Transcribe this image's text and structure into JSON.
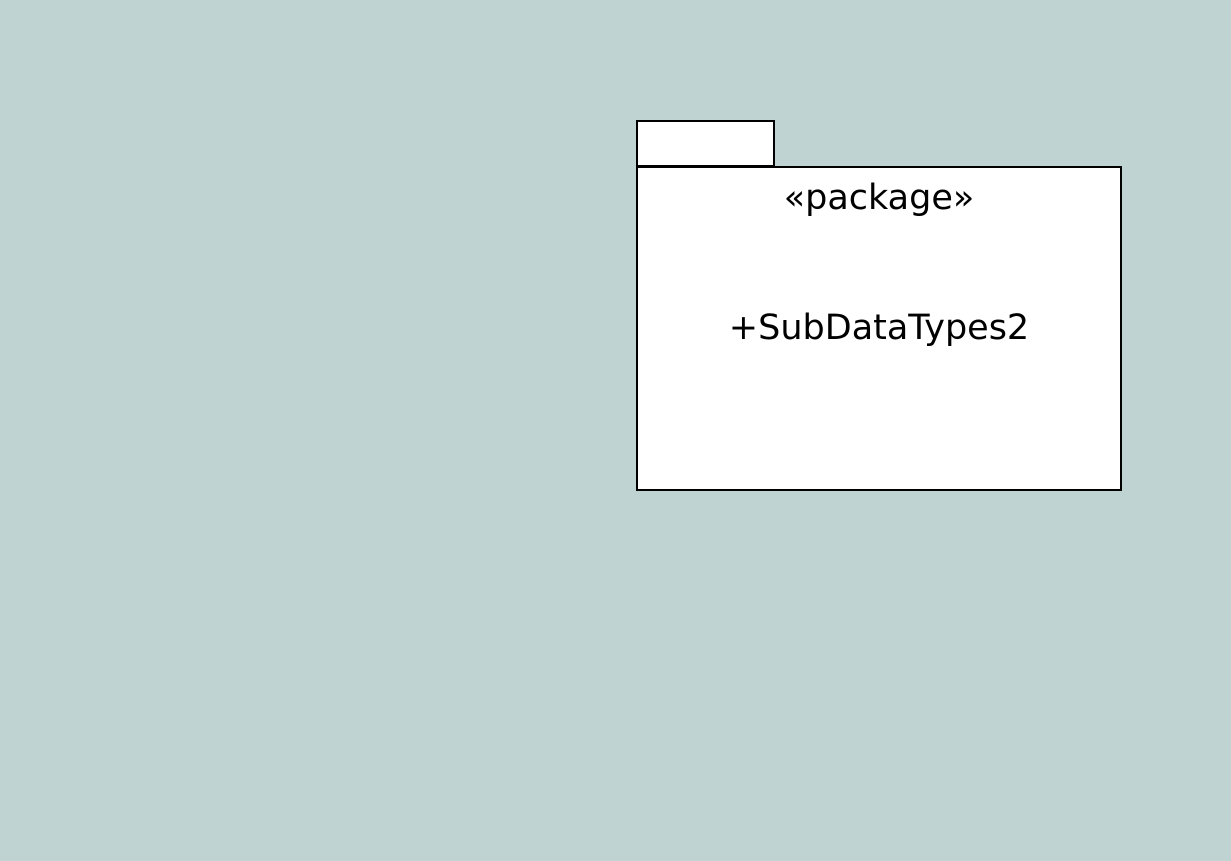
{
  "diagram": {
    "background_color": "#bfd3d2",
    "package": {
      "stereotype": "«package»",
      "name": "+SubDataTypes2",
      "fill_color": "#ffffff",
      "stroke_color": "#000000"
    }
  }
}
